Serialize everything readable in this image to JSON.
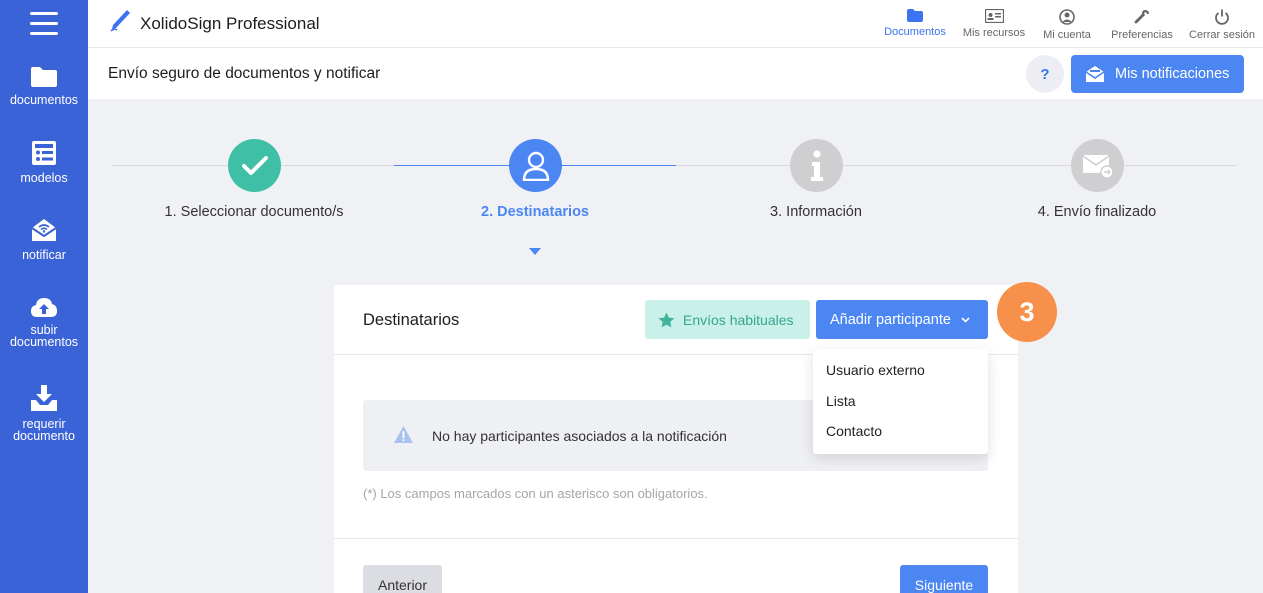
{
  "app": {
    "title": "XolidoSign Professional"
  },
  "sidebar": {
    "items": [
      {
        "label": "documentos"
      },
      {
        "label": "modelos"
      },
      {
        "label": "notificar"
      },
      {
        "label": "subir documentos"
      },
      {
        "label": "requerir documento"
      }
    ]
  },
  "top_nav": {
    "items": [
      {
        "label": "Documentos",
        "icon": "folder-icon"
      },
      {
        "label": "Mis recursos",
        "icon": "id-card-icon"
      },
      {
        "label": "Mi cuenta",
        "icon": "user-icon"
      },
      {
        "label": "Preferencias",
        "icon": "wrench-icon"
      },
      {
        "label": "Cerrar sesión",
        "icon": "power-icon"
      }
    ],
    "active": "Documentos"
  },
  "subheader": {
    "title": "Envío seguro de documentos y notificar",
    "help_label": "?",
    "notifications_label": "Mis notificaciones"
  },
  "stepper": {
    "steps": [
      {
        "label": "1. Seleccionar documento/s",
        "state": "done"
      },
      {
        "label": "2. Destinatarios",
        "state": "active"
      },
      {
        "label": "3. Información",
        "state": "pending"
      },
      {
        "label": "4. Envío finalizado",
        "state": "pending"
      }
    ]
  },
  "card": {
    "title": "Destinatarios",
    "favorites_label": "Envíos habituales",
    "add_participant_label": "Añadir participante",
    "empty_message": "No hay participantes asociados a la notificación",
    "hint": "(*) Los campos marcados con un asterisco son obligatorios.",
    "prev_label": "Anterior",
    "next_label": "Siguiente"
  },
  "dropdown": {
    "options": [
      "Usuario externo",
      "Lista",
      "Contacto"
    ]
  },
  "tutorial_badge": "3",
  "colors": {
    "sidebar": "#3b63d8",
    "primary": "#4b86f2",
    "success": "#3fbfa6",
    "badge": "#f7904a"
  }
}
